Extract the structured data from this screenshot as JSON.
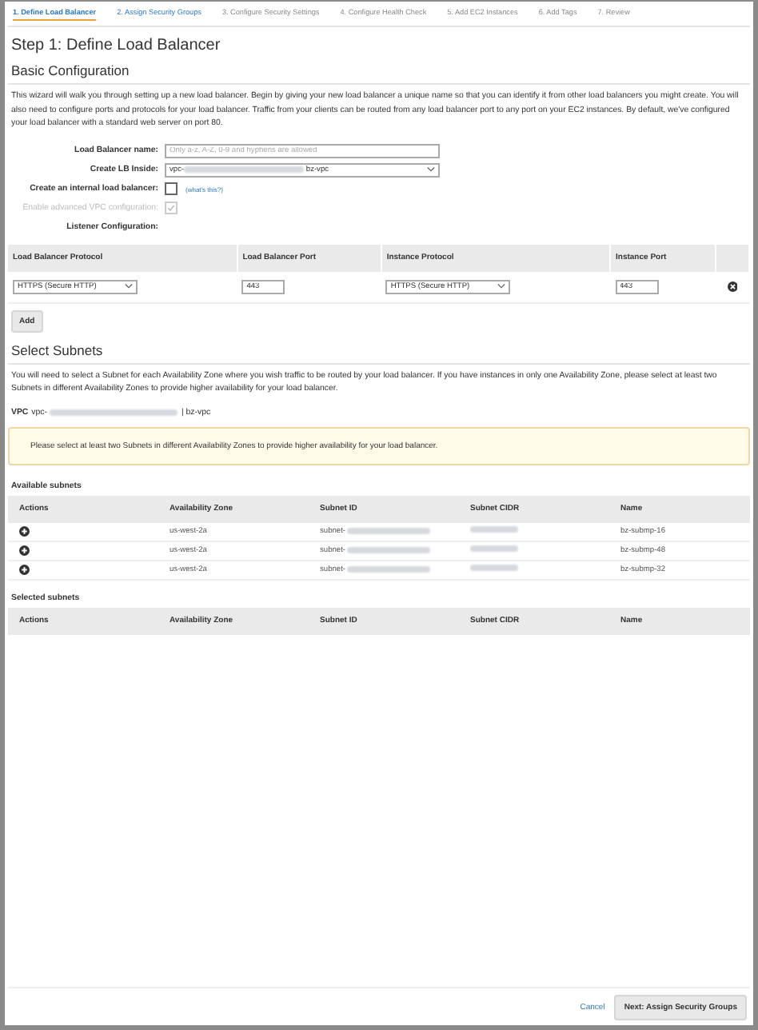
{
  "steps": [
    {
      "label": "1. Define Load Balancer",
      "selected": true,
      "enabled": true
    },
    {
      "label": "2. Assign Security Groups",
      "selected": false,
      "enabled": true
    },
    {
      "label": "3. Configure Security Settings",
      "selected": false,
      "enabled": false
    },
    {
      "label": "4. Configure Health Check",
      "selected": false,
      "enabled": false
    },
    {
      "label": "5. Add EC2 Instances",
      "selected": false,
      "enabled": false
    },
    {
      "label": "6. Add Tags",
      "selected": false,
      "enabled": false
    },
    {
      "label": "7. Review",
      "selected": false,
      "enabled": false
    }
  ],
  "title": "Step 1: Define Load Balancer",
  "basic": {
    "heading": "Basic Configuration",
    "intro": "This wizard will walk you through setting up a new load balancer. Begin by giving your new load balancer a unique name so that you can identify it from other load balancers you might create. You will also need to configure ports and protocols for your load balancer. Traffic from your clients can be routed from any load balancer port to any port on your EC2 instances. By default, we've configured your load balancer with a standard web server on port 80.",
    "name_label": "Load Balancer name:",
    "name_placeholder": "Only a-z, A-Z, 0-9 and hyphens are allowed",
    "vpc_label": "Create LB Inside:",
    "vpc_prefix": "vpc-",
    "vpc_suffix": "bz-vpc",
    "internal_label": "Create an internal load balancer:",
    "internal_checked": false,
    "whats_this": "(what's this?)",
    "advanced_label": "Enable advanced VPC configuration:",
    "advanced_checked": true,
    "advanced_disabled": true,
    "listener_label": "Listener Configuration:"
  },
  "listeners": {
    "columns": [
      "Load Balancer Protocol",
      "Load Balancer Port",
      "Instance Protocol",
      "Instance Port"
    ],
    "rows": [
      {
        "lb_protocol": "HTTPS (Secure HTTP)",
        "lb_port": "443",
        "instance_protocol": "HTTPS (Secure HTTP)",
        "instance_port": "443"
      }
    ],
    "add_button": "Add"
  },
  "subnets": {
    "heading": "Select Subnets",
    "intro": "You will need to select a Subnet for each Availability Zone where you wish traffic to be routed by your load balancer. If you have instances in only one Availability Zone, please select at least two Subnets in different Availability Zones to provide higher availability for your load balancer.",
    "vpc_label": "VPC",
    "vpc_prefix": "vpc-",
    "vpc_suffix": "| bz-vpc",
    "warning": "Please select at least two Subnets in different Availability Zones to provide higher availability for your load balancer.",
    "available_title": "Available subnets",
    "columns": [
      "Actions",
      "Availability Zone",
      "Subnet ID",
      "Subnet CIDR",
      "Name"
    ],
    "available": [
      {
        "zone": "us-west-2a",
        "id_prefix": "subnet-",
        "name": "bz-submp-16"
      },
      {
        "zone": "us-west-2a",
        "id_prefix": "subnet-",
        "name": "bz-submp-48"
      },
      {
        "zone": "us-west-2a",
        "id_prefix": "subnet-",
        "name": "bz-submp-32"
      }
    ],
    "selected_title": "Selected subnets",
    "selected_columns": [
      "Actions",
      "Availability Zone",
      "Subnet ID",
      "Subnet CIDR",
      "Name"
    ]
  },
  "footer": {
    "cancel": "Cancel",
    "next": "Next: Assign Security Groups"
  }
}
